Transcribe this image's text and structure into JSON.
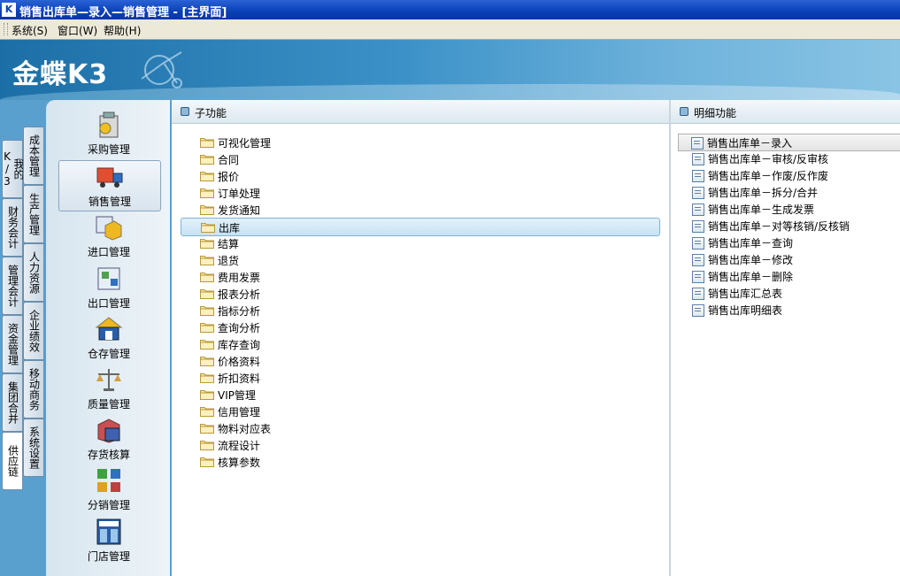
{
  "window": {
    "icon": "K",
    "title": "销售出库单—录入—销售管理 - [主界面]"
  },
  "menu": [
    {
      "label": "系统(S)"
    },
    {
      "label": "窗口(W)"
    },
    {
      "label": "帮助(H)"
    }
  ],
  "banner": {
    "logo_text": "金蝶K3"
  },
  "vtabs_outer": [
    {
      "label": "我的K/3"
    },
    {
      "label": "财务会计"
    },
    {
      "label": "管理会计"
    },
    {
      "label": "资金管理"
    },
    {
      "label": "集团合并"
    },
    {
      "label": "供应链",
      "selected": true
    }
  ],
  "vtabs_inner": [
    {
      "label": "成本管理"
    },
    {
      "label": "生产管理"
    },
    {
      "label": "人力资源"
    },
    {
      "label": "企业绩效"
    },
    {
      "label": "移动商务"
    },
    {
      "label": "系统设置"
    }
  ],
  "modules": [
    {
      "label": "采购管理",
      "icon": "purchase-icon"
    },
    {
      "label": "销售管理",
      "icon": "sales-truck-icon",
      "selected": true
    },
    {
      "label": "进口管理",
      "icon": "import-icon"
    },
    {
      "label": "出口管理",
      "icon": "export-icon"
    },
    {
      "label": "仓存管理",
      "icon": "warehouse-icon"
    },
    {
      "label": "质量管理",
      "icon": "quality-scale-icon"
    },
    {
      "label": "存货核算",
      "icon": "inventory-calc-icon"
    },
    {
      "label": "分销管理",
      "icon": "distribution-icon"
    },
    {
      "label": "门店管理",
      "icon": "shop-icon"
    }
  ],
  "subfunc": {
    "header": "子功能",
    "items": [
      {
        "label": "可视化管理"
      },
      {
        "label": "合同"
      },
      {
        "label": "报价"
      },
      {
        "label": "订单处理"
      },
      {
        "label": "发货通知"
      },
      {
        "label": "出库",
        "selected": true
      },
      {
        "label": "结算"
      },
      {
        "label": "退货"
      },
      {
        "label": "费用发票"
      },
      {
        "label": "报表分析"
      },
      {
        "label": "指标分析"
      },
      {
        "label": "查询分析"
      },
      {
        "label": "库存查询"
      },
      {
        "label": "价格资料"
      },
      {
        "label": "折扣资料"
      },
      {
        "label": "VIP管理"
      },
      {
        "label": "信用管理"
      },
      {
        "label": "物料对应表"
      },
      {
        "label": "流程设计"
      },
      {
        "label": "核算参数"
      }
    ]
  },
  "detail": {
    "header": "明细功能",
    "items": [
      {
        "label": "销售出库单－录入",
        "selected": true
      },
      {
        "label": "销售出库单－审核/反审核"
      },
      {
        "label": "销售出库单－作废/反作废"
      },
      {
        "label": "销售出库单－拆分/合并"
      },
      {
        "label": "销售出库单－生成发票"
      },
      {
        "label": "销售出库单－对等核销/反核销"
      },
      {
        "label": "销售出库单－查询"
      },
      {
        "label": "销售出库单－修改"
      },
      {
        "label": "销售出库单－删除"
      },
      {
        "label": "销售出库汇总表"
      },
      {
        "label": "销售出库明细表"
      }
    ]
  }
}
